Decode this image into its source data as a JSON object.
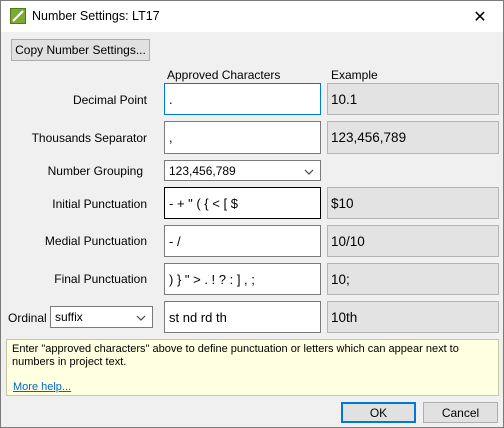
{
  "window": {
    "title": "Number Settings: LT17",
    "close_glyph": "✕"
  },
  "toolbar": {
    "copy_button": "Copy Number Settings..."
  },
  "columns": {
    "approved": "Approved Characters",
    "example": "Example"
  },
  "rows": {
    "decimal": {
      "label": "Decimal Point",
      "value": ".",
      "example": "10.1"
    },
    "thousands": {
      "label": "Thousands Separator",
      "value": ",",
      "example": "123,456,789"
    },
    "grouping": {
      "label": "Number Grouping",
      "selected": "123,456,789"
    },
    "initial": {
      "label": "Initial Punctuation",
      "value": "- + \" ( { < [ $",
      "example": "$10"
    },
    "medial": {
      "label": "Medial Punctuation",
      "value": "- /",
      "example": "10/10"
    },
    "final": {
      "label": "Final Punctuation",
      "value": ") } \" > . ! ? : ] , ;",
      "example": "10;"
    },
    "ordinal": {
      "label": "Ordinal",
      "selected": "suffix",
      "value": "st nd rd th",
      "example": "10th"
    }
  },
  "help": {
    "text": "Enter \"approved characters\" above to define punctuation or letters which can appear next to numbers in project text.",
    "link": "More help..."
  },
  "buttons": {
    "ok": "OK",
    "cancel": "Cancel"
  },
  "colors": {
    "focus": "#0078d7",
    "help_bg": "#ffffe1",
    "link": "#0066cc"
  }
}
